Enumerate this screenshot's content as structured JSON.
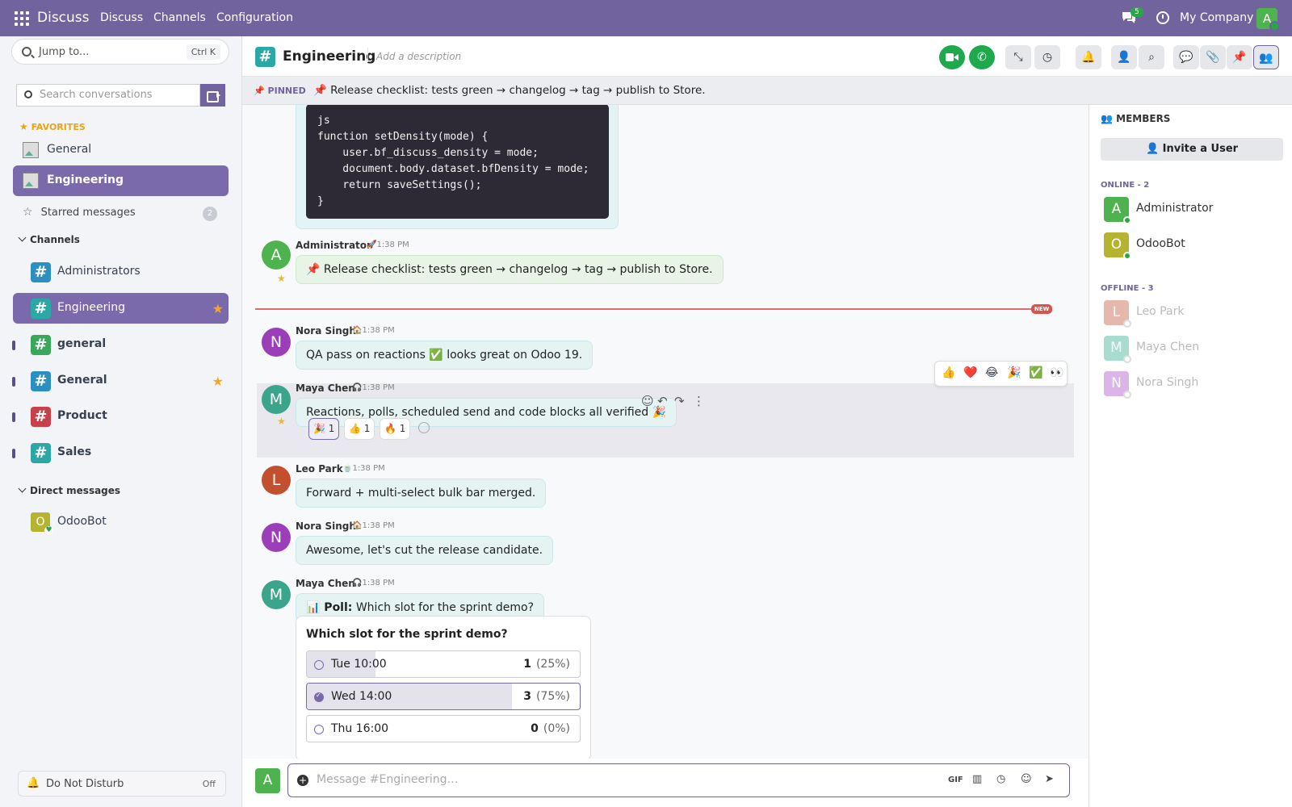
{
  "topbar": {
    "app_name": "Discuss",
    "menu": [
      "Discuss",
      "Channels",
      "Configuration"
    ],
    "chat_badge": "5",
    "company": "My Company",
    "user_initial": "A"
  },
  "sidebar": {
    "jump_to": "Jump to...",
    "jump_shortcut": "Ctrl K",
    "search_placeholder": "Search conversations",
    "favorites_label": "FAVORITES",
    "favorites": [
      {
        "label": "General"
      },
      {
        "label": "Engineering"
      }
    ],
    "starred_label": "Starred messages",
    "starred_count": "2",
    "channels_label": "Channels",
    "channels": [
      {
        "label": "Administrators",
        "color": "#2b8fc1"
      },
      {
        "label": "Engineering",
        "color": "#2ba7a5"
      },
      {
        "label": "general",
        "color": "#3aa85a"
      },
      {
        "label": "General",
        "color": "#2b8fc1"
      },
      {
        "label": "Product",
        "color": "#c7414a"
      },
      {
        "label": "Sales",
        "color": "#2ba7a5"
      }
    ],
    "dm_label": "Direct messages",
    "dms": [
      {
        "label": "OdooBot",
        "initial": "O"
      }
    ],
    "dnd_label": "Do Not Disturb",
    "dnd_state": "Off"
  },
  "header": {
    "channel_name": "Engineering",
    "description_placeholder": "Add a description"
  },
  "pinned": {
    "label": "PINNED",
    "text": "📌 Release checklist: tests green → changelog → tag → publish to Store."
  },
  "code": {
    "text": "js\nfunction setDensity(mode) {\n    user.bf_discuss_density = mode;\n    document.body.dataset.bfDensity = mode;\n    return saveSettings();\n}"
  },
  "messages": [
    {
      "author": "Administrator",
      "initial": "A",
      "status": "🚀",
      "time": "1:38 PM",
      "text": "📌 Release checklist: tests green → changelog → tag → publish to Store.",
      "color": "#4eb34e"
    },
    {
      "author": "Nora Singh",
      "initial": "N",
      "status": "🏠",
      "time": "1:38 PM",
      "text": "QA pass on reactions ✅ looks great on Odoo 19.",
      "color": "#9a3fb8"
    },
    {
      "author": "Maya Chen",
      "initial": "M",
      "status": "🎧",
      "time": "1:38 PM",
      "text": "Reactions, polls, scheduled send and code blocks all verified 🎉",
      "color": "#3aa58a"
    },
    {
      "author": "Leo Park",
      "initial": "L",
      "status": "🍵",
      "time": "1:38 PM",
      "text": "Forward + multi-select bulk bar merged.",
      "color": "#c2502f"
    },
    {
      "author": "Nora Singh",
      "initial": "N",
      "status": "🏠",
      "time": "1:38 PM",
      "text": "Awesome, let's cut the release candidate.",
      "color": "#9a3fb8"
    },
    {
      "author": "Maya Chen",
      "initial": "M",
      "status": "🎧",
      "time": "1:38 PM",
      "poll_prefix": "📊 Poll:",
      "text": "Which slot for the sprint demo?",
      "color": "#3aa58a"
    }
  ],
  "new_tag": "NEW",
  "reactions": [
    {
      "emoji": "🎉",
      "count": "1"
    },
    {
      "emoji": "👍",
      "count": "1"
    },
    {
      "emoji": "🔥",
      "count": "1"
    }
  ],
  "quick_emojis": [
    "👍",
    "❤️",
    "😂",
    "🎉",
    "✅",
    "👀"
  ],
  "poll": {
    "question": "Which slot for the sprint demo?",
    "options": [
      {
        "label": "Tue 10:00",
        "votes": "1",
        "pct": "(25%)",
        "fraction": 0.25,
        "selected": false
      },
      {
        "label": "Wed 14:00",
        "votes": "3",
        "pct": "(75%)",
        "fraction": 0.75,
        "selected": true
      },
      {
        "label": "Thu 16:00",
        "votes": "0",
        "pct": "(0%)",
        "fraction": 0,
        "selected": false
      }
    ]
  },
  "composer": {
    "placeholder": "Message #Engineering…",
    "gif_label": "GIF"
  },
  "members": {
    "title": "MEMBERS",
    "invite_label": "Invite a User",
    "online_label": "ONLINE - 2",
    "offline_label": "OFFLINE - 3",
    "online": [
      {
        "name": "Administrator",
        "initial": "A",
        "color": "#4eb34e"
      },
      {
        "name": "OdooBot",
        "initial": "O",
        "color": "#b5b32f"
      }
    ],
    "offline": [
      {
        "name": "Leo Park",
        "initial": "L",
        "color": "#e6b7ac"
      },
      {
        "name": "Maya Chen",
        "initial": "M",
        "color": "#a8dccf"
      },
      {
        "name": "Nora Singh",
        "initial": "N",
        "color": "#dcb5e8"
      }
    ]
  }
}
